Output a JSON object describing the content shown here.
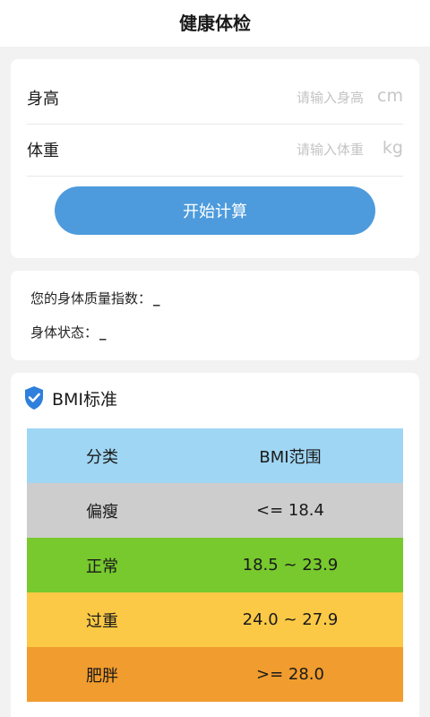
{
  "header": {
    "title": "健康体检"
  },
  "form": {
    "height": {
      "label": "身高",
      "placeholder": "请输入身高",
      "unit": "cm"
    },
    "weight": {
      "label": "体重",
      "placeholder": "请输入体重",
      "unit": "kg"
    },
    "calculate_label": "开始计算"
  },
  "result": {
    "bmi_label": "您的身体质量指数：",
    "bmi_value": "_",
    "status_label": "身体状态：",
    "status_value": "_"
  },
  "standard": {
    "title": "BMI标准",
    "icon": "shield-check-icon",
    "columns": [
      "分类",
      "BMI范围"
    ],
    "rows": [
      {
        "category": "偏瘦",
        "range": "<= 18.4",
        "color": "#cdcdcd"
      },
      {
        "category": "正常",
        "range": "18.5 ~ 23.9",
        "color": "#77c92e"
      },
      {
        "category": "过重",
        "range": "24.0 ~ 27.9",
        "color": "#fbc945"
      },
      {
        "category": "肥胖",
        "range": ">= 28.0",
        "color": "#f19c2e"
      }
    ],
    "header_color": "#9fd6f3"
  },
  "colors": {
    "accent": "#4d9bdc",
    "icon": "#2f7fdc"
  }
}
